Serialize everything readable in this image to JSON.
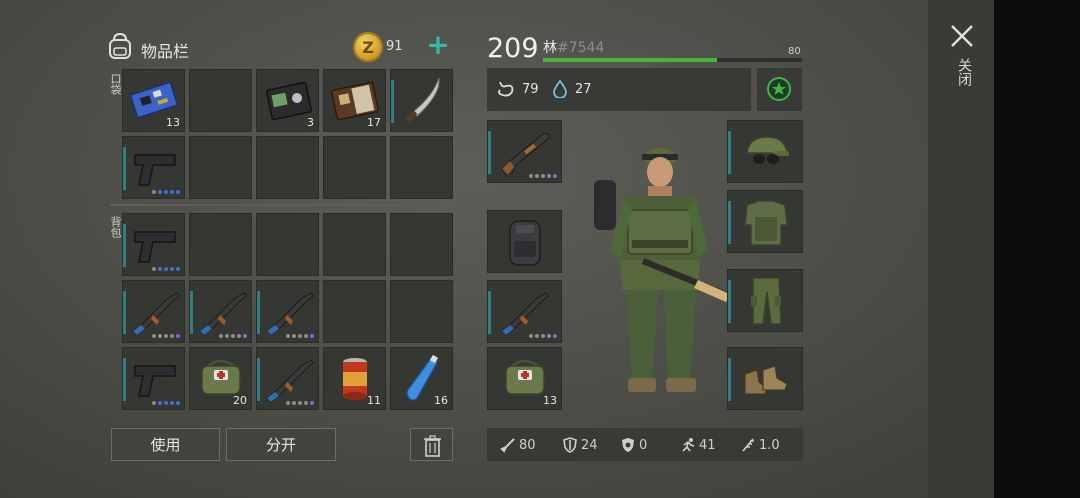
{
  "window": {
    "close_label": "关闭"
  },
  "inventory": {
    "title": "物品栏",
    "coins": "91",
    "pocket_label": "口袋",
    "backpack_label": "背包",
    "pocket_slots": [
      {
        "item": "circuit-board",
        "qty": "13"
      },
      {
        "item": "empty"
      },
      {
        "item": "id-wallet",
        "qty": "3"
      },
      {
        "item": "notebook",
        "qty": "17"
      },
      {
        "item": "machete"
      },
      {
        "item": "pistol"
      },
      {
        "item": "empty"
      },
      {
        "item": "empty"
      },
      {
        "item": "empty"
      },
      {
        "item": "empty"
      }
    ],
    "backpack_slots": [
      {
        "item": "pistol"
      },
      {
        "item": "empty"
      },
      {
        "item": "empty"
      },
      {
        "item": "empty"
      },
      {
        "item": "empty"
      },
      {
        "item": "ak-rifle"
      },
      {
        "item": "ak-rifle"
      },
      {
        "item": "ak-rifle"
      },
      {
        "item": "empty"
      },
      {
        "item": "empty"
      },
      {
        "item": "pistol"
      },
      {
        "item": "medkit-bag",
        "qty": "20"
      },
      {
        "item": "ak-rifle"
      },
      {
        "item": "food-can",
        "qty": "11"
      },
      {
        "item": "water-bottle",
        "qty": "16"
      }
    ],
    "use_button": "使用",
    "split_button": "分开"
  },
  "character": {
    "level": "209",
    "name": "林",
    "tag": "#7544",
    "xp_max": "80",
    "xp_fraction": 0.67,
    "hunger": "79",
    "thirst": "27",
    "weapon_slots": [
      {
        "item": "shotgun"
      },
      {
        "item": "backpack"
      },
      {
        "item": "ak-rifle"
      },
      {
        "item": "medkit-bag",
        "qty": "13"
      }
    ],
    "gear_slots": [
      {
        "item": "cap-with-goggles"
      },
      {
        "item": "body-armor"
      },
      {
        "item": "camo-pants"
      },
      {
        "item": "boots"
      }
    ],
    "bottom_stats": {
      "attack": "80",
      "armor": "24",
      "protection": "0",
      "speed": "41",
      "weight": "1.0"
    }
  },
  "colors": {
    "accent": "#35b8ad",
    "xp": "#4ab33e",
    "rarity_blue": "#3e6fd8",
    "rarity_purple": "#9a5bd8"
  }
}
